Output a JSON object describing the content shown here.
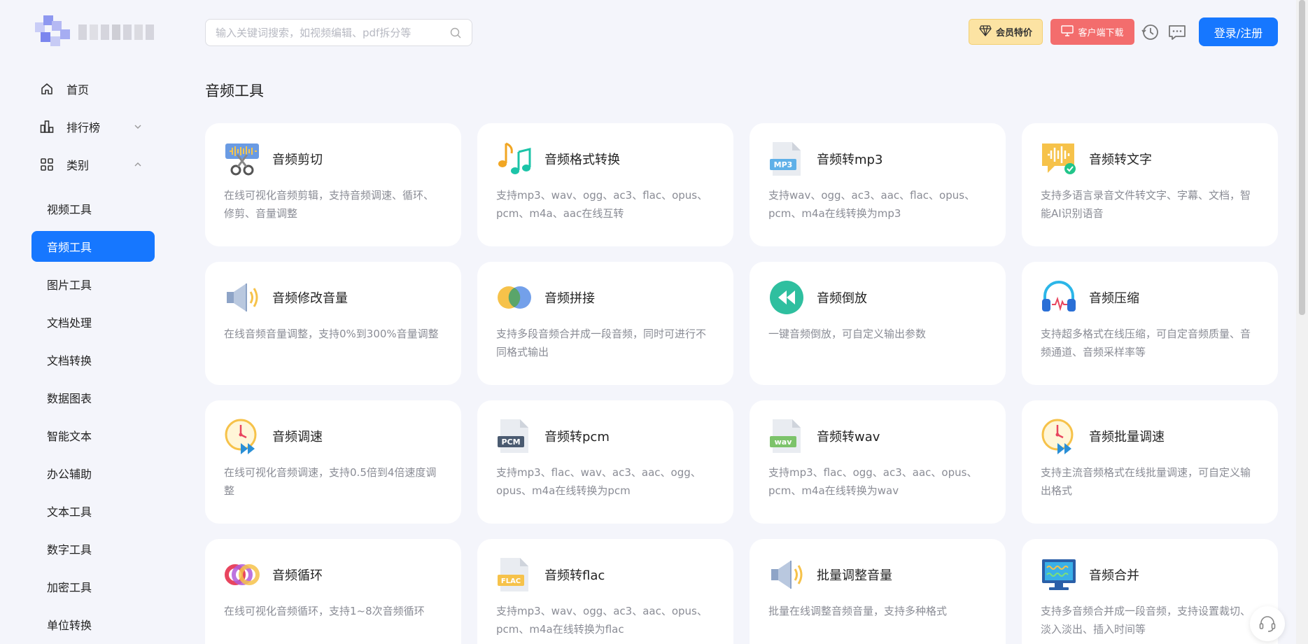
{
  "search": {
    "placeholder": "输入关键词搜索，如视频编辑、pdf拆分等"
  },
  "header": {
    "vip_label": "会员特价",
    "download_label": "客户端下载",
    "login_label": "登录/注册"
  },
  "nav": {
    "main": [
      {
        "label": "首页",
        "icon": "home-icon"
      },
      {
        "label": "排行榜",
        "icon": "ranking-icon"
      },
      {
        "label": "类别",
        "icon": "category-icon"
      }
    ],
    "sub": [
      {
        "label": "视频工具"
      },
      {
        "label": "音频工具",
        "active": true
      },
      {
        "label": "图片工具"
      },
      {
        "label": "文档处理"
      },
      {
        "label": "文档转换"
      },
      {
        "label": "数据图表"
      },
      {
        "label": "智能文本"
      },
      {
        "label": "办公辅助"
      },
      {
        "label": "文本工具"
      },
      {
        "label": "数字工具"
      },
      {
        "label": "加密工具"
      },
      {
        "label": "单位转换"
      }
    ]
  },
  "section": {
    "title": "音频工具"
  },
  "tools": [
    {
      "title": "音频剪切",
      "desc": "在线可视化音频剪辑，支持音频调速、循环、修剪、音量调整",
      "icon": "audio-cut-icon"
    },
    {
      "title": "音频格式转换",
      "desc": "支持mp3、wav、ogg、ac3、flac、opus、pcm、m4a、aac在线互转",
      "icon": "music-notes-icon"
    },
    {
      "title": "音频转mp3",
      "desc": "支持wav、ogg、ac3、aac、flac、opus、pcm、m4a在线转换为mp3",
      "icon": "mp3-file-icon"
    },
    {
      "title": "音频转文字",
      "desc": "支持多语言录音文件转文字、字幕、文档，智能AI识别语音",
      "icon": "speech-to-text-icon"
    },
    {
      "title": "音频修改音量",
      "desc": "在线音频音量调整，支持0%到300%音量调整",
      "icon": "speaker-icon"
    },
    {
      "title": "音频拼接",
      "desc": "支持多段音频合并成一段音频，同时可进行不同格式输出",
      "icon": "merge-circles-icon"
    },
    {
      "title": "音频倒放",
      "desc": "一键音频倒放，可自定义输出参数",
      "icon": "rewind-icon"
    },
    {
      "title": "音频压缩",
      "desc": "支持超多格式在线压缩，可自定音频质量、音频通道、音频采样率等",
      "icon": "headphones-icon"
    },
    {
      "title": "音频调速",
      "desc": "在线可视化音频调速，支持0.5倍到4倍速度调整",
      "icon": "speed-clock-icon"
    },
    {
      "title": "音频转pcm",
      "desc": "支持mp3、flac、wav、ac3、aac、ogg、opus、m4a在线转换为pcm",
      "icon": "pcm-file-icon"
    },
    {
      "title": "音频转wav",
      "desc": "支持mp3、flac、ogg、ac3、aac、opus、pcm、m4a在线转换为wav",
      "icon": "wav-file-icon"
    },
    {
      "title": "音频批量调速",
      "desc": "支持主流音频格式在线批量调速，可自定义输出格式",
      "icon": "speed-clock-icon"
    },
    {
      "title": "音频循环",
      "desc": "在线可视化音频循环，支持1~8次音频循环",
      "icon": "loop-icon"
    },
    {
      "title": "音频转flac",
      "desc": "支持mp3、wav、ogg、ac3、aac、opus、pcm、m4a在线转换为flac",
      "icon": "flac-file-icon"
    },
    {
      "title": "批量调整音量",
      "desc": "批量在线调整音频音量，支持多种格式",
      "icon": "speaker-icon"
    },
    {
      "title": "音频合并",
      "desc": "支持多音频合并成一段音频，支持设置裁切、淡入淡出、插入时间等",
      "icon": "monitor-wave-icon"
    }
  ],
  "colors": {
    "primary": "#1677ff",
    "download": "#f36d6d",
    "vip": "#fce3a3",
    "background": "#f4f5fb"
  }
}
